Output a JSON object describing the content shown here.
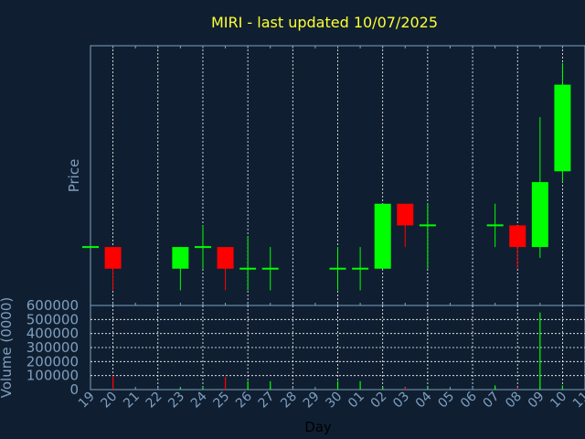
{
  "title": "MIRI - last updated 10/07/2025",
  "colors": {
    "background": "#0f1f31",
    "title": "#ffff33",
    "axis_text": "#7f9fbf",
    "frame": "#7f9fbf",
    "grid": "#ffffff",
    "up": "#00ff00",
    "down": "#ff0000"
  },
  "chart_data": {
    "type": "candlestick",
    "title": "MIRI - last updated 10/07/2025",
    "xlabel": "Day",
    "ylabel_price": "Price",
    "ylabel_volume": "Volume (0000)",
    "x_ticks": [
      "19",
      "20",
      "21",
      "22",
      "23",
      "24",
      "25",
      "26",
      "27",
      "28",
      "29",
      "30",
      "01",
      "02",
      "03",
      "04",
      "05",
      "06",
      "07",
      "08",
      "09",
      "10",
      "11"
    ],
    "volume_ticks": [
      "0",
      "100000",
      "200000",
      "300000",
      "400000",
      "500000",
      "600000"
    ],
    "volume_ylim": [
      0,
      600000
    ],
    "price_axis_labels_shown": false,
    "price_ylim": [
      0,
      120
    ],
    "candles": [
      {
        "x": 0.0,
        "open": 27,
        "close": 27,
        "high": 27,
        "low": 27,
        "volume": 0
      },
      {
        "x": 1.0,
        "open": 27,
        "close": 17,
        "high": 27,
        "low": 7,
        "volume": 100000
      },
      {
        "x": 4.0,
        "open": 17,
        "close": 27,
        "high": 27,
        "low": 7,
        "volume": 15000
      },
      {
        "x": 5.0,
        "open": 27,
        "close": 27,
        "high": 37,
        "low": 17,
        "volume": 15000
      },
      {
        "x": 6.0,
        "open": 27,
        "close": 17,
        "high": 27,
        "low": 7,
        "volume": 90000
      },
      {
        "x": 7.0,
        "open": 17,
        "close": 17,
        "high": 32,
        "low": 7,
        "volume": 60000
      },
      {
        "x": 8.0,
        "open": 17,
        "close": 17,
        "high": 27,
        "low": 7,
        "volume": 60000
      },
      {
        "x": 11.0,
        "open": 17,
        "close": 17,
        "high": 27,
        "low": 7,
        "volume": 60000
      },
      {
        "x": 12.0,
        "open": 17,
        "close": 17,
        "high": 27,
        "low": 7,
        "volume": 60000
      },
      {
        "x": 13.0,
        "open": 17,
        "close": 47,
        "high": 47,
        "low": 17,
        "volume": 15000
      },
      {
        "x": 14.0,
        "open": 47,
        "close": 37,
        "high": 47,
        "low": 27,
        "volume": 15000
      },
      {
        "x": 15.0,
        "open": 37,
        "close": 37,
        "high": 47,
        "low": 17,
        "volume": 15000
      },
      {
        "x": 18.0,
        "open": 37,
        "close": 37,
        "high": 47,
        "low": 27,
        "volume": 30000
      },
      {
        "x": 19.0,
        "open": 37,
        "close": 27,
        "high": 37,
        "low": 17,
        "volume": 15000
      },
      {
        "x": 20.0,
        "open": 27,
        "close": 57,
        "high": 87,
        "low": 22,
        "volume": 550000
      },
      {
        "x": 21.0,
        "open": 62,
        "close": 102,
        "high": 112,
        "low": 57,
        "volume": 30000
      }
    ]
  }
}
